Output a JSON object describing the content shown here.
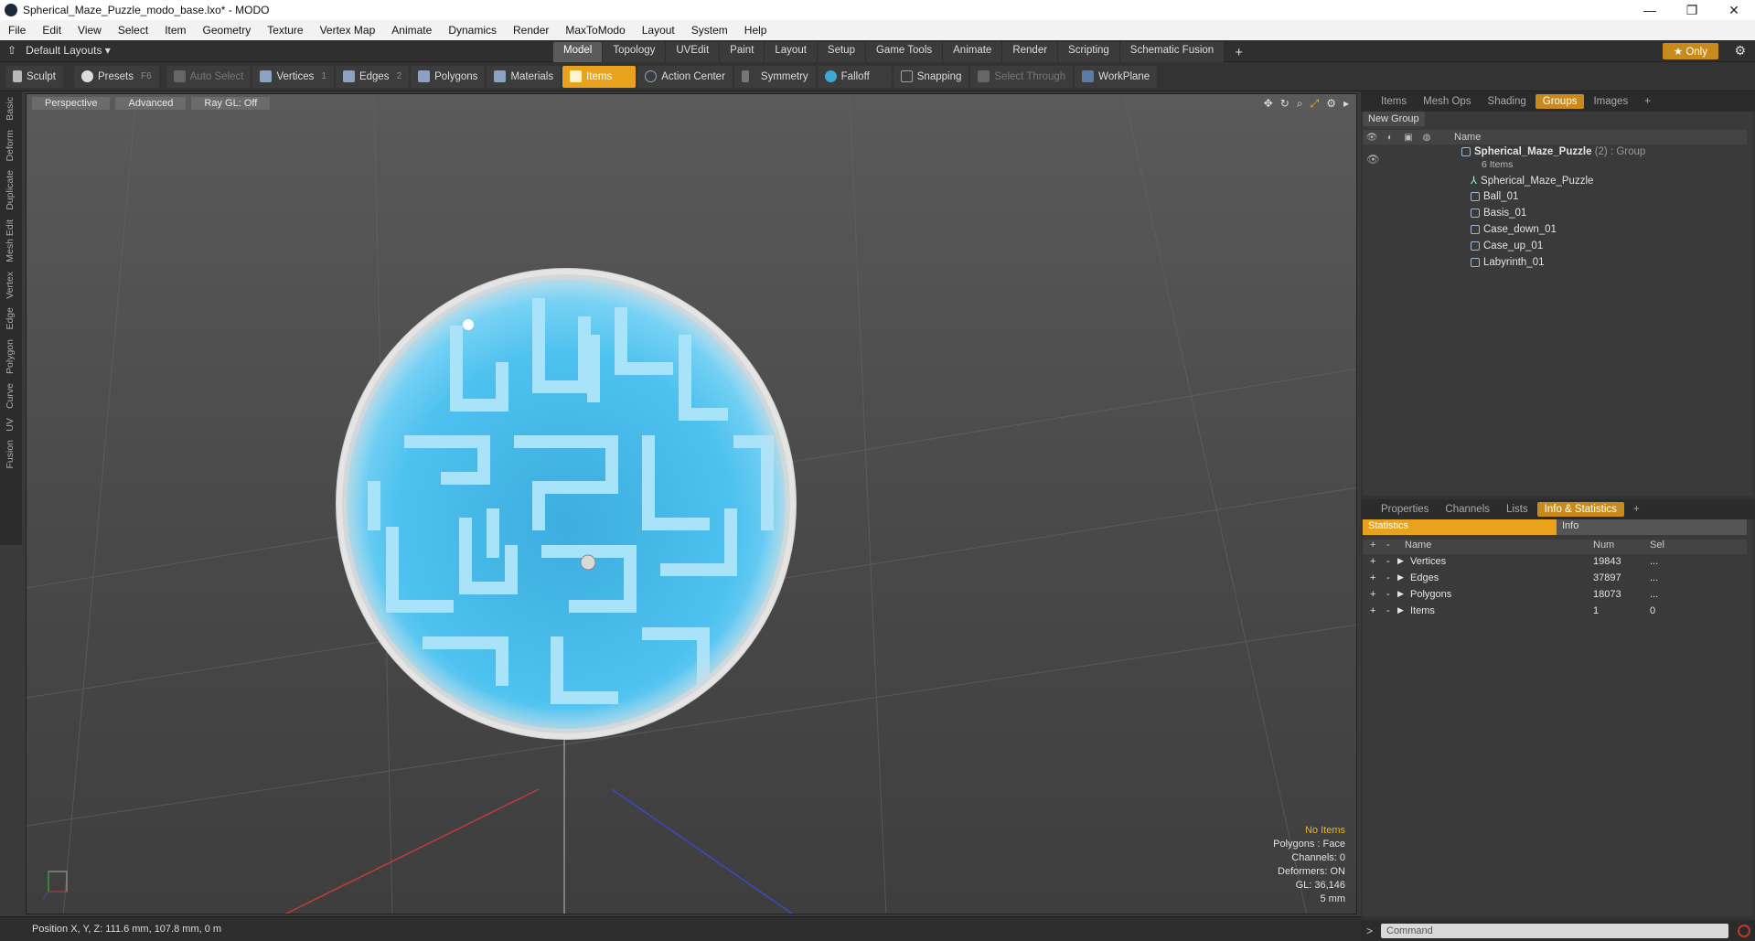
{
  "window": {
    "title": "Spherical_Maze_Puzzle_modo_base.lxo* - MODO",
    "controls": [
      "—",
      "❐",
      "✕"
    ]
  },
  "menu": [
    "File",
    "Edit",
    "View",
    "Select",
    "Item",
    "Geometry",
    "Texture",
    "Vertex Map",
    "Animate",
    "Dynamics",
    "Render",
    "MaxToModo",
    "Layout",
    "System",
    "Help"
  ],
  "layoutbar": {
    "layout_label": "Default Layouts",
    "tabs": [
      "Model",
      "Topology",
      "UVEdit",
      "Paint",
      "Layout",
      "Setup",
      "Game Tools",
      "Animate",
      "Render",
      "Scripting",
      "Schematic Fusion"
    ],
    "active_tab": "Model",
    "add": "+",
    "only_label": "Only"
  },
  "toolbar": {
    "sculpt": "Sculpt",
    "presets": "Presets",
    "presets_key": "F6",
    "auto_select": "Auto Select",
    "vertices": "Vertices",
    "vertices_key": "1",
    "edges": "Edges",
    "edges_key": "2",
    "polygons": "Polygons",
    "materials": "Materials",
    "items": "Items",
    "action_center": "Action Center",
    "symmetry": "Symmetry",
    "falloff": "Falloff",
    "snapping": "Snapping",
    "select_through": "Select Through",
    "workplane": "WorkPlane"
  },
  "left_tabs": [
    "Basic",
    "Deform",
    "Duplicate",
    "Mesh Edit",
    "Vertex",
    "Edge",
    "Polygon",
    "Curve",
    "UV",
    "Fusion"
  ],
  "viewport": {
    "view_mode": "Perspective",
    "shading": "Advanced",
    "raygl": "Ray GL: Off",
    "info": {
      "selection": "No Items",
      "polygons": "Polygons : Face",
      "channels": "Channels: 0",
      "deformers": "Deformers: ON",
      "gl": "GL: 36,146",
      "scale": "5 mm"
    }
  },
  "statusbar": {
    "position": "Position X, Y, Z:   111.6 mm, 107.8 mm, 0 m"
  },
  "groups_panel": {
    "tabs": [
      "Items",
      "Mesh Ops",
      "Shading",
      "Groups",
      "Images"
    ],
    "active_tab": "Groups",
    "new_group": "New Group",
    "column_name": "Name",
    "group_name": "Spherical_Maze_Puzzle",
    "group_suffix": "(2) : Group",
    "group_count": "6 Items",
    "children": [
      "Spherical_Maze_Puzzle",
      "Ball_01",
      "Basis_01",
      "Case_down_01",
      "Case_up_01",
      "Labyrinth_01"
    ]
  },
  "stats_panel": {
    "tabs": [
      "Properties",
      "Channels",
      "Lists",
      "Info & Statistics"
    ],
    "active_tab": "Info & Statistics",
    "subtabs": [
      "Statistics",
      "Info"
    ],
    "columns": {
      "name": "Name",
      "num": "Num",
      "sel": "Sel"
    },
    "rows": [
      {
        "name": "Vertices",
        "num": "19843",
        "sel": "..."
      },
      {
        "name": "Edges",
        "num": "37897",
        "sel": "..."
      },
      {
        "name": "Polygons",
        "num": "18073",
        "sel": "..."
      },
      {
        "name": "Items",
        "num": "1",
        "sel": "0"
      }
    ]
  },
  "command": {
    "prompt": ">",
    "placeholder": "Command"
  }
}
